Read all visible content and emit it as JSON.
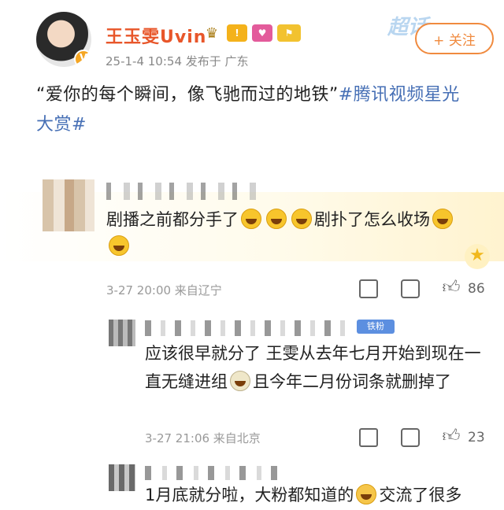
{
  "post": {
    "author_name": "王玉雯Uvin",
    "time": "25-1-4 10:54  发布于 广东",
    "follow_label": "+ 关注",
    "super_text": "超话",
    "text_plain": "“爱你的每个瞬间，像飞驰而过的地铁”",
    "text_tag": "#腾讯视频星光大赏#"
  },
  "comment": {
    "text_1": "剧播之前都分手了",
    "text_2": "剧扑了怎么收场",
    "meta": "3-27 20:00  来自辽宁",
    "like_count": "86"
  },
  "reply_1": {
    "fan_badge": "铁粉",
    "text_1": "应该很早就分了  王雯从去年七月开始到现在一直无缝进组",
    "text_2": "且今年二月份词条就删掉了",
    "meta": "3-27 21:06  来自北京",
    "like_count": "23"
  },
  "reply_2": {
    "text_1": "1月底就分啦，大粉都知道的",
    "text_2": "交流了很多"
  },
  "icons": {
    "share": "share-icon",
    "comment": "comment-icon",
    "like": "thumbs-up-icon",
    "laugh_emoji": "laughing-crying-emoji",
    "thinking_emoji": "thinking-emoji",
    "hug_emoji": "hug-emoji"
  },
  "colors": {
    "author_name": "#e8562a",
    "tag": "#466fb5",
    "follow": "#f08a3e"
  }
}
